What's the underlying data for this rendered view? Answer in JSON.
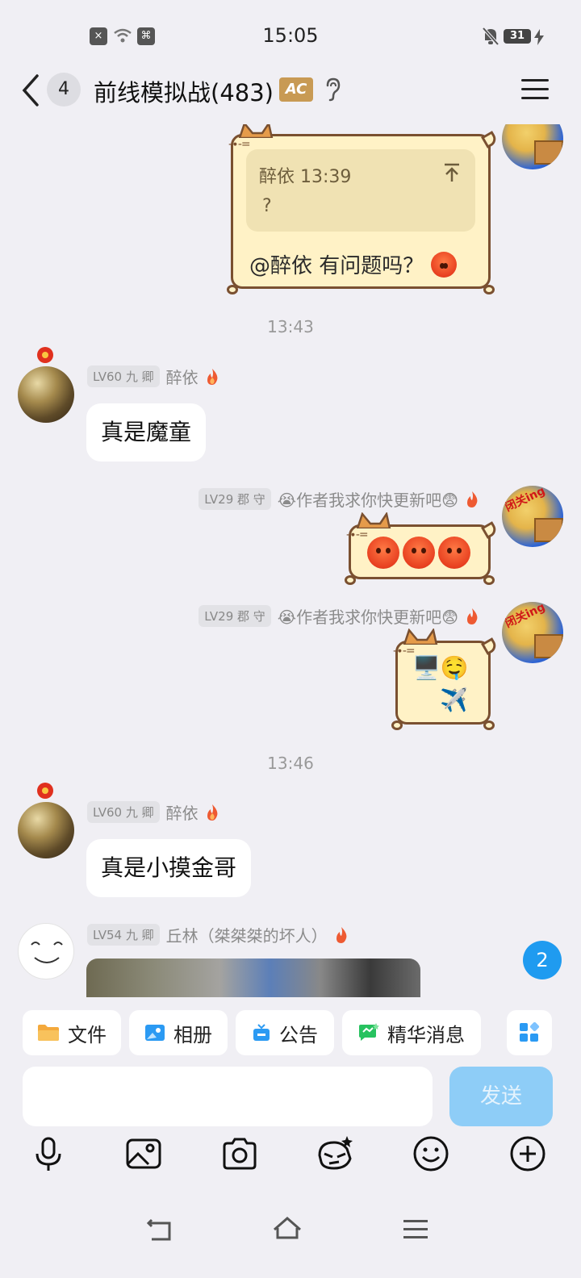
{
  "status_bar": {
    "time": "15:05",
    "battery": "31"
  },
  "header": {
    "back_badge": "4",
    "title": "前线模拟战(483)",
    "badge_text": "AC"
  },
  "messages": {
    "reply": {
      "quote_name": "醉依 13:39",
      "quote_text": "?",
      "text": "@醉依 有问题吗？"
    },
    "ts1": "13:43",
    "m1": {
      "level": "LV60 九 卿",
      "nick": "醉依",
      "text": "真是魔童"
    },
    "m2": {
      "level": "LV29 郡 守",
      "nick": "😭作者我求你快更新吧😨"
    },
    "m3": {
      "level": "LV29 郡 守",
      "nick": "😭作者我求你快更新吧😨",
      "line1": "🖥️🤤",
      "line2": "✈️"
    },
    "ts2": "13:46",
    "m4": {
      "level": "LV60 九 卿",
      "nick": "醉依",
      "text": "真是小摸金哥"
    },
    "m5": {
      "level": "LV54 九 卿",
      "nick": "丘林（桀桀桀的坏人）"
    }
  },
  "unread_count": "2",
  "shortcuts": [
    {
      "label": "文件",
      "icon": "folder-icon",
      "color": "#f4a93c"
    },
    {
      "label": "相册",
      "icon": "album-icon",
      "color": "#2b9af3"
    },
    {
      "label": "公告",
      "icon": "announcement-icon",
      "color": "#2b9af3"
    },
    {
      "label": "精华消息",
      "icon": "highlight-icon",
      "color": "#27c25f"
    }
  ],
  "input": {
    "send_label": "发送"
  },
  "toolbar": [
    "mic-icon",
    "image-icon",
    "camera-icon",
    "sticker-icon",
    "emoji-icon",
    "plus-icon"
  ],
  "colors": {
    "accent": "#1f9bf0",
    "send_disabled": "#8ecdf7",
    "cat_bubble": "#fff2c6"
  }
}
